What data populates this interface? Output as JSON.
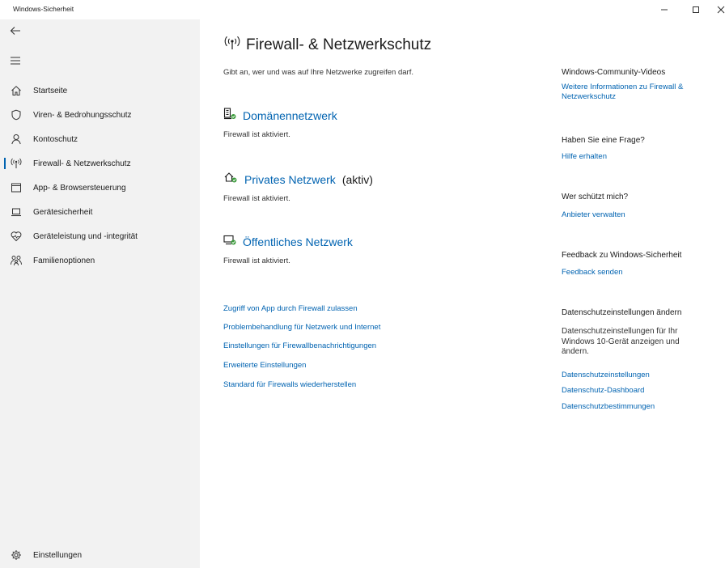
{
  "window": {
    "title": "Windows-Sicherheit",
    "controls": {
      "minimize": "–",
      "maximize": "☐",
      "close": "✕"
    }
  },
  "sidebar": {
    "back_icon": "arrow-left-icon",
    "menu_icon": "hamburger-icon",
    "items": [
      {
        "label": "Startseite",
        "icon": "home-icon"
      },
      {
        "label": "Viren- & Bedrohungsschutz",
        "icon": "shield-icon"
      },
      {
        "label": "Kontoschutz",
        "icon": "person-icon"
      },
      {
        "label": "Firewall- & Netzwerkschutz",
        "icon": "antenna-icon",
        "active": true
      },
      {
        "label": "App- & Browsersteuerung",
        "icon": "browser-window-icon"
      },
      {
        "label": "Gerätesicherheit",
        "icon": "laptop-icon"
      },
      {
        "label": "Geräteleistung und -integrität",
        "icon": "heart-pulse-icon"
      },
      {
        "label": "Familienoptionen",
        "icon": "family-icon"
      }
    ],
    "settings": {
      "label": "Einstellungen",
      "icon": "gear-icon"
    }
  },
  "main": {
    "title": "Firewall- & Netzwerkschutz",
    "subtitle": "Gibt an, wer und was auf Ihre Netzwerke zugreifen darf.",
    "networks": [
      {
        "name": "Domänennetzwerk",
        "extra": "",
        "status": "Firewall ist aktiviert.",
        "icon": "domain-network-icon"
      },
      {
        "name": "Privates Netzwerk",
        "extra": "(aktiv)",
        "status": "Firewall ist aktiviert.",
        "icon": "private-network-icon"
      },
      {
        "name": "Öffentliches Netzwerk",
        "extra": "",
        "status": "Firewall ist aktiviert.",
        "icon": "public-network-icon"
      }
    ],
    "links": [
      "Zugriff von App durch Firewall zulassen",
      "Problembehandlung für Netzwerk und Internet",
      "Einstellungen für Firewallbenachrichtigungen",
      "Erweiterte Einstellungen",
      "Standard für Firewalls wiederherstellen"
    ]
  },
  "right_panel": {
    "videos": {
      "heading": "Windows-Community-Videos",
      "link": "Weitere Informationen zu Firewall & Netzwerkschutz"
    },
    "question": {
      "heading": "Haben Sie eine Frage?",
      "link": "Hilfe erhalten"
    },
    "protection": {
      "heading": "Wer schützt mich?",
      "link": "Anbieter verwalten"
    },
    "feedback": {
      "heading": "Feedback zu Windows-Sicherheit",
      "link": "Feedback senden"
    },
    "privacy": {
      "heading": "Datenschutzeinstellungen ändern",
      "text": "Datenschutzeinstellungen für Ihr Windows 10-Gerät anzeigen und ändern.",
      "links": [
        "Datenschutzeinstellungen",
        "Datenschutz-Dashboard",
        "Datenschutzbestimmungen"
      ]
    }
  },
  "colors": {
    "accent": "#0063b1",
    "sidebar_bg": "#f2f2f2",
    "status_green": "#3a9a3a"
  }
}
